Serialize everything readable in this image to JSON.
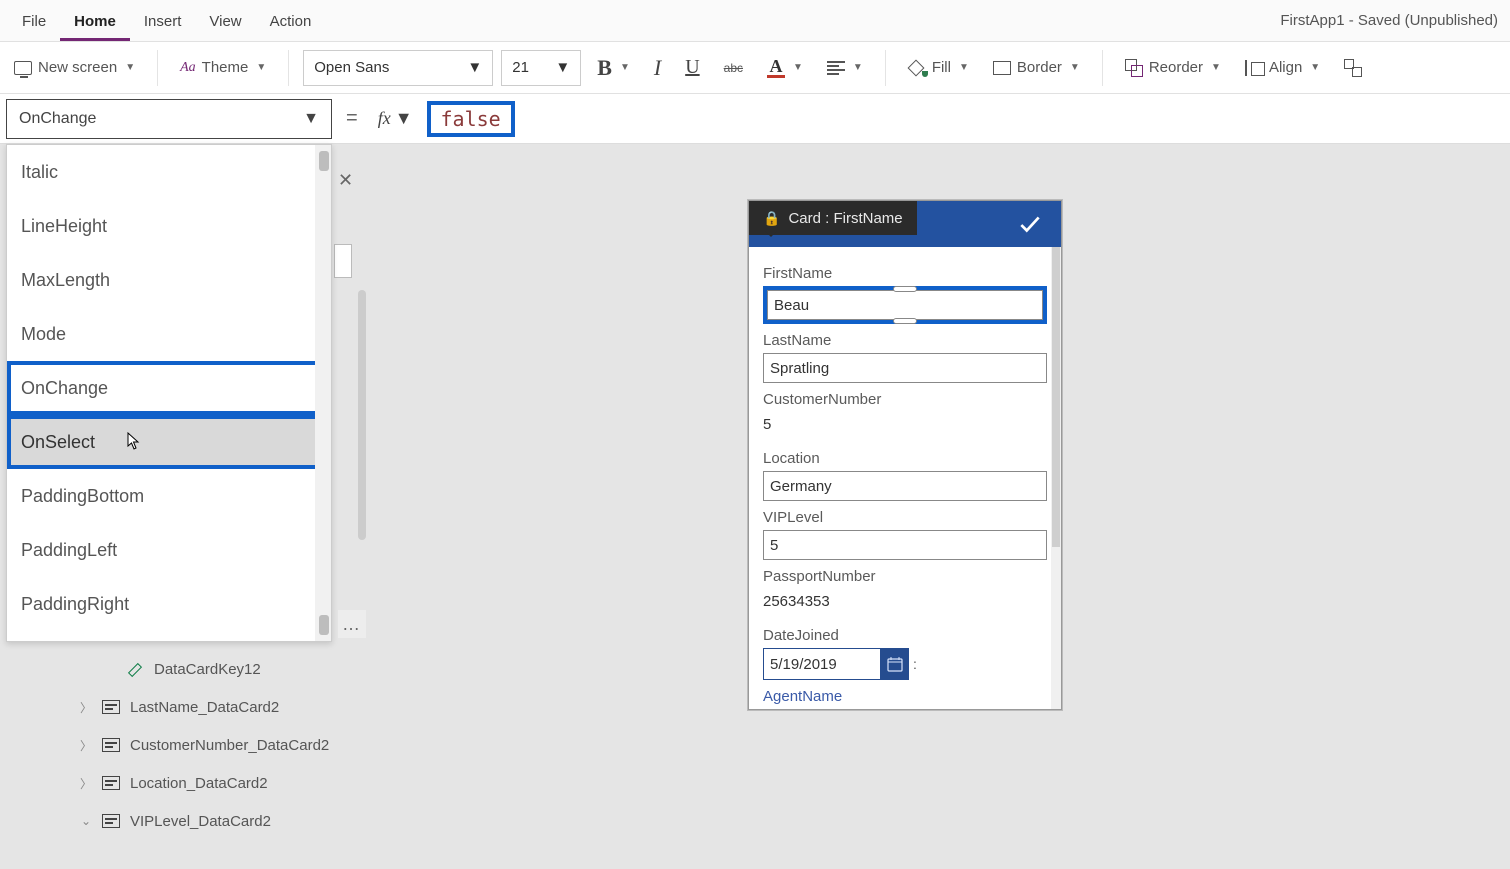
{
  "app_title": "FirstApp1 - Saved (Unpublished)",
  "menu": {
    "file": "File",
    "home": "Home",
    "insert": "Insert",
    "view": "View",
    "action": "Action"
  },
  "ribbon": {
    "new_screen": "New screen",
    "theme": "Theme",
    "font": "Open Sans",
    "size": "21",
    "fill": "Fill",
    "border": "Border",
    "reorder": "Reorder",
    "align": "Align"
  },
  "prop_selector": "OnChange",
  "formula_value": "false",
  "dropdown": [
    "Italic",
    "LineHeight",
    "MaxLength",
    "Mode",
    "OnChange",
    "OnSelect",
    "PaddingBottom",
    "PaddingLeft",
    "PaddingRight"
  ],
  "tree": {
    "datakey": "DataCardKey12",
    "lastname": "LastName_DataCard2",
    "custnum": "CustomerNumber_DataCard2",
    "location": "Location_DataCard2",
    "viplevel": "VIPLevel_DataCard2"
  },
  "card": {
    "chip": "Card : FirstName",
    "firstname_label": "FirstName",
    "firstname_val": "Beau",
    "lastname_label": "LastName",
    "lastname_val": "Spratling",
    "custnum_label": "CustomerNumber",
    "custnum_val": "5",
    "location_label": "Location",
    "location_val": "Germany",
    "viplevel_label": "VIPLevel",
    "viplevel_val": "5",
    "passport_label": "PassportNumber",
    "passport_val": "25634353",
    "datejoined_label": "DateJoined",
    "datejoined_val": "5/19/2019",
    "agent_label": "AgentName"
  }
}
